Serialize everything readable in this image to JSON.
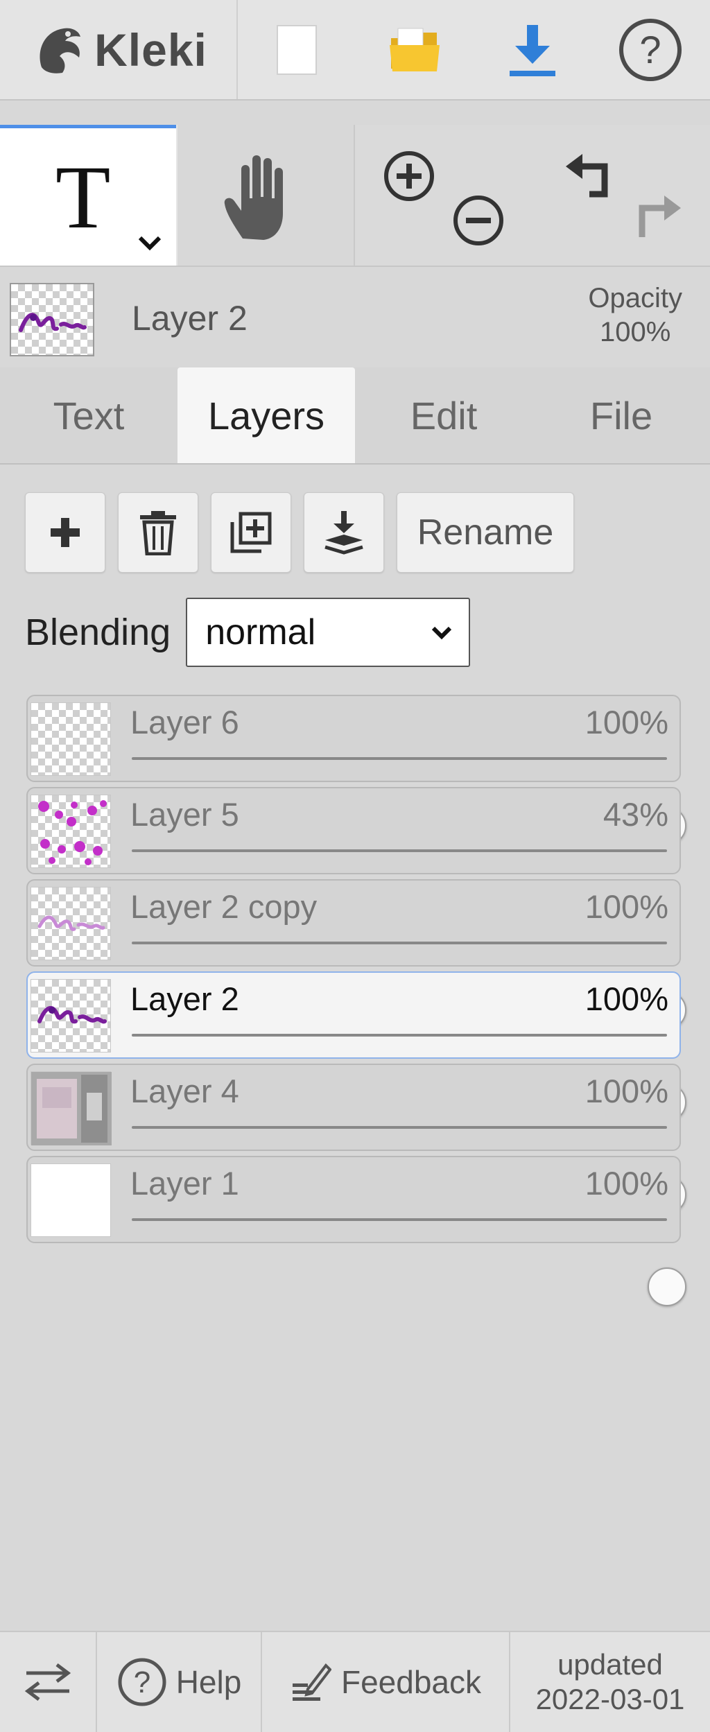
{
  "app": {
    "name": "Kleki"
  },
  "topbar": {
    "icons": [
      "kleki-logo-icon",
      "new-file-icon",
      "open-folder-icon",
      "download-icon",
      "help-icon"
    ],
    "colors": {
      "folder": "#f4c430",
      "download": "#2f7fd8"
    }
  },
  "tools": {
    "text_glyph": "T",
    "active": "text",
    "items": [
      "text-tool",
      "hand-tool",
      "zoom-in",
      "zoom-out",
      "undo",
      "redo"
    ]
  },
  "current_layer": {
    "name": "Layer 2",
    "opacity_label": "Opacity",
    "opacity_value": "100%"
  },
  "tabs": [
    {
      "label": "Text",
      "active": false
    },
    {
      "label": "Layers",
      "active": true
    },
    {
      "label": "Edit",
      "active": false
    },
    {
      "label": "File",
      "active": false
    }
  ],
  "layer_actions": {
    "icons": [
      "add-layer-icon",
      "delete-layer-icon",
      "duplicate-layer-icon",
      "merge-down-icon"
    ],
    "rename_label": "Rename"
  },
  "blending": {
    "label": "Blending",
    "value": "normal"
  },
  "layers": [
    {
      "name": "Layer 6",
      "opacity_text": "100%",
      "opacity": 1.0,
      "selected": false,
      "thumb": "checker"
    },
    {
      "name": "Layer 5",
      "opacity_text": "43%",
      "opacity": 0.43,
      "selected": false,
      "thumb": "dots"
    },
    {
      "name": "Layer 2 copy",
      "opacity_text": "100%",
      "opacity": 1.0,
      "selected": false,
      "thumb": "scribble-light"
    },
    {
      "name": "Layer 2",
      "opacity_text": "100%",
      "opacity": 1.0,
      "selected": true,
      "thumb": "scribble"
    },
    {
      "name": "Layer 4",
      "opacity_text": "100%",
      "opacity": 1.0,
      "selected": false,
      "thumb": "photo"
    },
    {
      "name": "Layer 1",
      "opacity_text": "100%",
      "opacity": 1.0,
      "selected": false,
      "thumb": "white"
    }
  ],
  "bottombar": {
    "help_label": "Help",
    "feedback_label": "Feedback",
    "updated_label": "updated",
    "updated_date": "2022-03-01"
  }
}
